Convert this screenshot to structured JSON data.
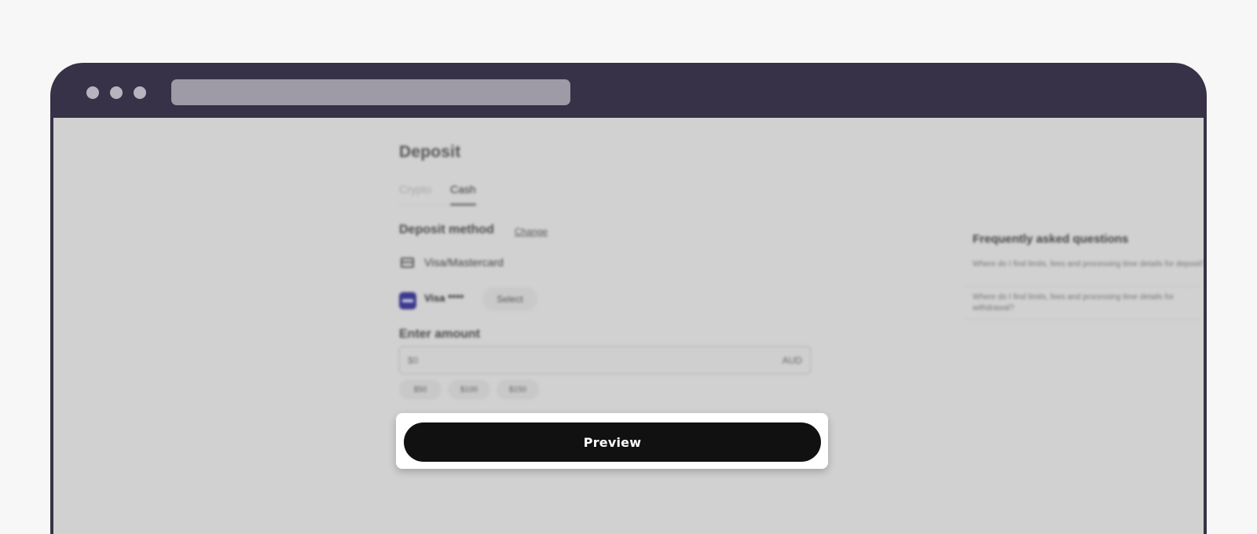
{
  "page": {
    "title": "Deposit",
    "tabs": [
      {
        "label": "Crypto",
        "active": false
      },
      {
        "label": "Cash",
        "active": true
      }
    ]
  },
  "deposit_method": {
    "label": "Deposit method",
    "change_label": "Change",
    "method_name": "Visa/Mastercard",
    "method_icon": "credit-card-icon",
    "card_label": "Visa ****",
    "card_icon": "visa-logo-icon",
    "select_label": "Select"
  },
  "amount": {
    "label": "Enter amount",
    "placeholder": "$0",
    "currency": "AUD",
    "quick_amounts": [
      "$50",
      "$100",
      "$150"
    ]
  },
  "faq": {
    "title": "Frequently asked questions",
    "items": [
      "Where do I find limits, fees and processing time details for deposit?",
      "Where do I find limits, fees and processing time details for withdrawal?"
    ]
  },
  "action": {
    "preview_label": "Preview"
  },
  "colors": {
    "browser_chrome": "#373247",
    "button": "#111111",
    "overlay": "#d1d1d1"
  }
}
